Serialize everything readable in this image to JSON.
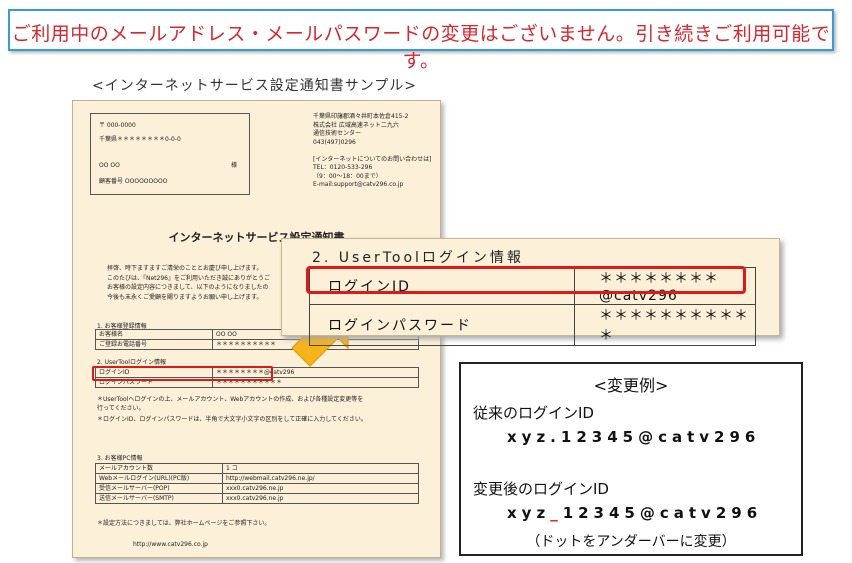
{
  "notice": {
    "text": "ご利用中のメールアドレス・メールパスワードの変更はございません。引き続きご利用可能です。"
  },
  "sample_caption": "<インターネットサービス設定通知書サンプル>",
  "doc": {
    "address_block": [
      "〒 000-0000",
      "千葉県＊＊＊＊＊＊＊＊0-0-0",
      "OO  OO",
      "様",
      "顧客番号  OOOOOOOOO"
    ],
    "isp_info": [
      "千葉県印旛郡酒々井町本佐倉415-2",
      "株式会社  広域高速ネット二九六",
      "通信技術センター",
      "043(497)0296",
      "",
      "[インターネットについてのお問い合わせは]",
      "TEL：0120-533-296",
      "（9：00～18：00まで）",
      "E-mail:support@catv296.co.jp"
    ],
    "title": "インターネットサービス設定通知書",
    "greeting": [
      "拝啓、時下ますますご清栄のこととお慶び申し上げます。",
      "このたびは、『Net296』をご利用いただき誠にありがとうご",
      "お客様の設定内容につきまして、以下のようになりましたの",
      "今後も末永くご愛顧を賜りますようお願い申し上げます。"
    ],
    "section1": {
      "heading": "1. お客様登録情報",
      "rows": [
        [
          "お客様名",
          "OO  OO"
        ],
        [
          "ご登録お電話番号",
          "＊＊＊＊＊＊＊＊＊＊"
        ]
      ]
    },
    "section2": {
      "heading": "2. UserToolログイン情報",
      "rows": [
        [
          "ログインID",
          "＊＊＊＊＊＊＊＊@catv296"
        ],
        [
          "ログインパスワード",
          "＊＊＊＊＊＊＊＊＊＊＊"
        ]
      ]
    },
    "notes": [
      "＊UserToolへログインの上、メールアカウント、Webアカウントの作成、および各種設定変更等を",
      "  行ってください。",
      "＊ログインID、ログインパスワードは、半角で大文字小文字の区別をして正確に入力してください。"
    ],
    "section3": {
      "heading": "3. お客様PC情報",
      "rows": [
        [
          "メールアカウント数",
          "1  コ"
        ],
        [
          "Webメールログイン(URL)(PC版)",
          "http://webmail.catv296.ne.jp/"
        ],
        [
          "受信メールサーバー(POP)",
          "xxx0.catv296.ne.jp"
        ],
        [
          "送信メールサーバー(SMTP)",
          "xxx0.catv296.ne.jp"
        ]
      ]
    },
    "footer_note": "＊設定方法につきましては、弊社ホームページをご参照下さい。",
    "url": "http://www.catv296.co.jp"
  },
  "zoom": {
    "title": "2. UserToolログイン情報",
    "login_id_label": "ログインID",
    "login_id_value": "＊＊＊＊＊＊＊＊@catv296",
    "password_label": "ログインパスワード",
    "password_value": "＊＊＊＊＊＊＊＊＊＊＊"
  },
  "example": {
    "heading": "<変更例>",
    "old_label": "従来のログインID",
    "old_value": "xyz.12345@catv296",
    "new_label": "変更後のログインID",
    "new_value_prefix": "xyz",
    "new_value_sep": "_",
    "new_value_suffix": "12345@catv296",
    "note": "（ドットをアンダーバーに変更）"
  },
  "colors": {
    "notice_text": "#d8262e",
    "notice_border": "#3a9ad6",
    "highlight": "#e01818",
    "doc_bg": "#fcf0d8",
    "arrow": "#f4b41a"
  }
}
